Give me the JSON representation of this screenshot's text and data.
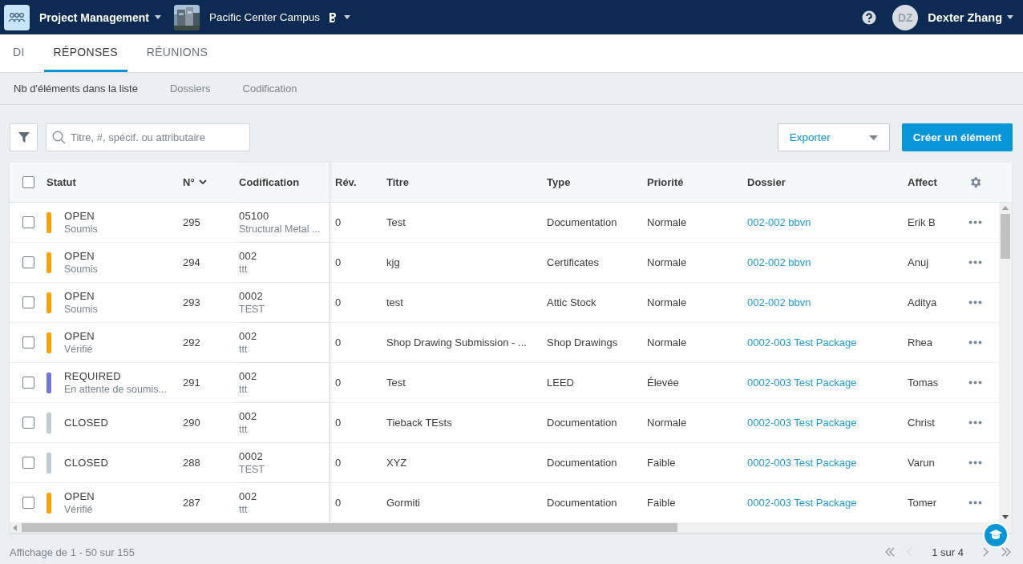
{
  "app": {
    "name": "Project Management",
    "project": "Pacific Center Campus",
    "user": {
      "initials": "DZ",
      "name": "Dexter Zhang"
    }
  },
  "tabs": [
    {
      "label": "DI",
      "selected": false
    },
    {
      "label": "RÉPONSES",
      "selected": true
    },
    {
      "label": "RÉUNIONS",
      "selected": false
    }
  ],
  "subtabs": [
    {
      "label": "Nb d'éléments dans la liste",
      "selected": true
    },
    {
      "label": "Dossiers",
      "selected": false
    },
    {
      "label": "Codification",
      "selected": false
    }
  ],
  "toolbar": {
    "search_placeholder": "Titre, #, spécif. ou attributaire",
    "export": "Exporter",
    "create": "Créer un élément"
  },
  "table": {
    "select_all_checked": false,
    "columns": [
      {
        "label": "Statut",
        "sorted": false
      },
      {
        "label": "N°",
        "sorted": true
      },
      {
        "label": "Codification",
        "sorted": false
      },
      {
        "label": "Rév.",
        "sorted": false
      },
      {
        "label": "Titre",
        "sorted": false
      },
      {
        "label": "Type",
        "sorted": false
      },
      {
        "label": "Priorité",
        "sorted": false
      },
      {
        "label": "Dossier",
        "sorted": false
      },
      {
        "label": "Affect",
        "sorted": false
      }
    ],
    "rows": [
      {
        "checked": false,
        "status": "OPEN",
        "substatus": "Soumis",
        "color": "#ffa000",
        "number": "295",
        "code": "05100",
        "code_name": "Structural Metal ...",
        "rev": "0",
        "title": "Test",
        "type": "Documentation",
        "priority": "Normale",
        "package": "002-002 bbvn",
        "assignee": "Erik B"
      },
      {
        "checked": false,
        "status": "OPEN",
        "substatus": "Soumis",
        "color": "#ffa000",
        "number": "294",
        "code": "002",
        "code_name": "ttt",
        "rev": "0",
        "title": "kjg",
        "type": "Certificates",
        "priority": "Normale",
        "package": "002-002 bbvn",
        "assignee": "Anuj"
      },
      {
        "checked": false,
        "status": "OPEN",
        "substatus": "Soumis",
        "color": "#ffa000",
        "number": "293",
        "code": "0002",
        "code_name": "TEST",
        "rev": "0",
        "title": "test",
        "type": "Attic Stock",
        "priority": "Normale",
        "package": "002-002 bbvn",
        "assignee": "Aditya"
      },
      {
        "checked": false,
        "status": "OPEN",
        "substatus": "Vérifié",
        "color": "#ffa000",
        "number": "292",
        "code": "002",
        "code_name": "ttt",
        "rev": "0",
        "title": "Shop Drawing Submission - ...",
        "type": "Shop Drawings",
        "priority": "Normale",
        "package": "0002-003 Test Package",
        "assignee": "Rhea"
      },
      {
        "checked": false,
        "status": "REQUIRED",
        "substatus": "En attente de soumis...",
        "color": "#7079cf",
        "number": "291",
        "code": "002",
        "code_name": "ttt",
        "rev": "0",
        "title": "Test",
        "type": "LEED",
        "priority": "Élevée",
        "package": "0002-003 Test Package",
        "assignee": "Tomas"
      },
      {
        "checked": false,
        "status": "CLOSED",
        "color": "#bfcad3",
        "number": "290",
        "code": "002",
        "code_name": "ttt",
        "rev": "0",
        "title": "Tieback TEsts",
        "type": "Documentation",
        "priority": "Normale",
        "package": "0002-003 Test Package",
        "assignee": "Christ"
      },
      {
        "checked": false,
        "status": "CLOSED",
        "color": "#bfcad3",
        "number": "288",
        "code": "0002",
        "code_name": "TEST",
        "rev": "0",
        "title": "XYZ",
        "type": "Documentation",
        "priority": "Faible",
        "package": "0002-003 Test Package",
        "assignee": "Varun"
      },
      {
        "checked": false,
        "status": "OPEN",
        "substatus": "Vérifié",
        "color": "#ffa000",
        "number": "287",
        "code": "002",
        "code_name": "ttt",
        "rev": "0",
        "title": "Gormiti",
        "type": "Documentation",
        "priority": "Faible",
        "package": "0002-003 Test Package",
        "assignee": "Tomer"
      }
    ]
  },
  "footer": {
    "summary": "Affichage de 1 - 50 sur 155",
    "page": "1 sur 4",
    "pager": [
      {
        "kind": "first",
        "disabled": false
      },
      {
        "kind": "prev",
        "disabled": true
      },
      {
        "kind": "next",
        "disabled": false
      },
      {
        "kind": "last",
        "disabled": false
      }
    ]
  }
}
